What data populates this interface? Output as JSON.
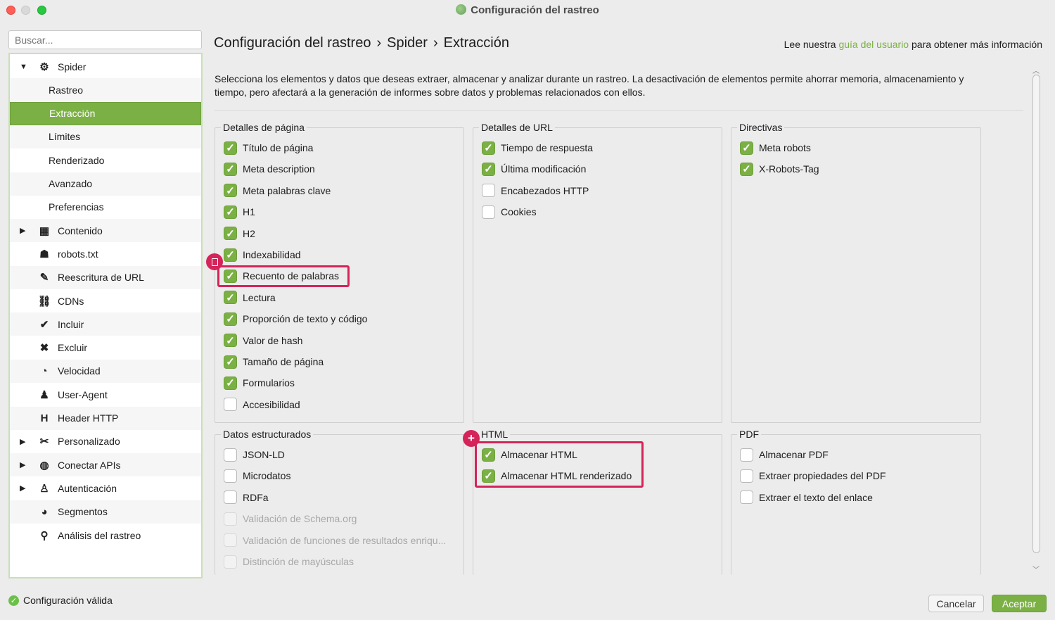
{
  "window": {
    "title": "Configuración del rastreo"
  },
  "sidebar": {
    "search_placeholder": "Buscar...",
    "items": [
      {
        "label": "Spider",
        "icon": "gear-icon",
        "arrow": "▼"
      },
      {
        "label": "Rastreo"
      },
      {
        "label": "Extracción",
        "selected": true
      },
      {
        "label": "Límites"
      },
      {
        "label": "Renderizado"
      },
      {
        "label": "Avanzado"
      },
      {
        "label": "Preferencias"
      },
      {
        "label": "Contenido",
        "icon": "table-icon",
        "arrow": "▶"
      },
      {
        "label": "robots.txt",
        "icon": "robot-icon"
      },
      {
        "label": "Reescritura de URL",
        "icon": "edit-icon"
      },
      {
        "label": "CDNs",
        "icon": "network-icon"
      },
      {
        "label": "Incluir",
        "icon": "check-circle-icon"
      },
      {
        "label": "Excluir",
        "icon": "x-circle-icon"
      },
      {
        "label": "Velocidad",
        "icon": "gauge-icon"
      },
      {
        "label": "User-Agent",
        "icon": "agent-icon"
      },
      {
        "label": "Header HTTP",
        "icon": "h-icon"
      },
      {
        "label": "Personalizado",
        "icon": "tools-icon",
        "arrow": "▶"
      },
      {
        "label": "Conectar APIs",
        "icon": "globe-icon",
        "arrow": "▶"
      },
      {
        "label": "Autenticación",
        "icon": "user-lock-icon",
        "arrow": "▶"
      },
      {
        "label": "Segmentos",
        "icon": "pie-icon"
      },
      {
        "label": "Análisis del rastreo",
        "icon": "search-icon"
      }
    ]
  },
  "status": {
    "text": "Configuración válida"
  },
  "header": {
    "breadcrumb": [
      "Configuración del rastreo",
      "Spider",
      "Extracción"
    ],
    "help_prefix": "Lee nuestra",
    "help_link": "guía del usuario",
    "help_suffix": "para obtener más información"
  },
  "intro": "Selecciona los elementos y datos que deseas extraer, almacenar y analizar durante un rastreo. La desactivación de elementos permite ahorrar memoria, almacenamiento y tiempo, pero afectará a la generación de informes sobre datos y problemas relacionados con ellos.",
  "groups": {
    "page_details": {
      "title": "Detalles de página",
      "items": [
        {
          "label": "Título de página",
          "checked": true
        },
        {
          "label": "Meta description",
          "checked": true
        },
        {
          "label": "Meta palabras clave",
          "checked": true
        },
        {
          "label": "H1",
          "checked": true
        },
        {
          "label": "H2",
          "checked": true
        },
        {
          "label": "Indexabilidad",
          "checked": true
        },
        {
          "label": "Recuento de palabras",
          "checked": true
        },
        {
          "label": "Lectura",
          "checked": true
        },
        {
          "label": "Proporción de texto y código",
          "checked": true
        },
        {
          "label": "Valor de hash",
          "checked": true
        },
        {
          "label": "Tamaño de página",
          "checked": true
        },
        {
          "label": "Formularios",
          "checked": true
        },
        {
          "label": "Accesibilidad",
          "checked": false
        }
      ]
    },
    "url_details": {
      "title": "Detalles de URL",
      "items": [
        {
          "label": "Tiempo de respuesta",
          "checked": true
        },
        {
          "label": "Última modificación",
          "checked": true
        },
        {
          "label": "Encabezados HTTP",
          "checked": false
        },
        {
          "label": "Cookies",
          "checked": false
        }
      ]
    },
    "directives": {
      "title": "Directivas",
      "items": [
        {
          "label": "Meta robots",
          "checked": true
        },
        {
          "label": "X-Robots-Tag",
          "checked": true
        }
      ]
    },
    "structured": {
      "title": "Datos estructurados",
      "items": [
        {
          "label": "JSON-LD",
          "checked": false
        },
        {
          "label": "Microdatos",
          "checked": false
        },
        {
          "label": "RDFa",
          "checked": false
        },
        {
          "label": "Validación de Schema.org",
          "checked": false,
          "disabled": true
        },
        {
          "label": "Validación de funciones de resultados enriqu...",
          "checked": false,
          "disabled": true
        },
        {
          "label": "Distinción de mayúsculas",
          "checked": false,
          "disabled": true
        }
      ]
    },
    "html": {
      "title": "HTML",
      "items": [
        {
          "label": "Almacenar HTML",
          "checked": true
        },
        {
          "label": "Almacenar HTML renderizado",
          "checked": true
        }
      ]
    },
    "pdf": {
      "title": "PDF",
      "items": [
        {
          "label": "Almacenar PDF",
          "checked": false
        },
        {
          "label": "Extraer propiedades del PDF",
          "checked": false
        },
        {
          "label": "Extraer el texto del enlace",
          "checked": false
        }
      ]
    }
  },
  "buttons": {
    "cancel": "Cancelar",
    "ok": "Aceptar"
  },
  "colors": {
    "accent": "#7bb144",
    "highlight": "#d4245a"
  }
}
